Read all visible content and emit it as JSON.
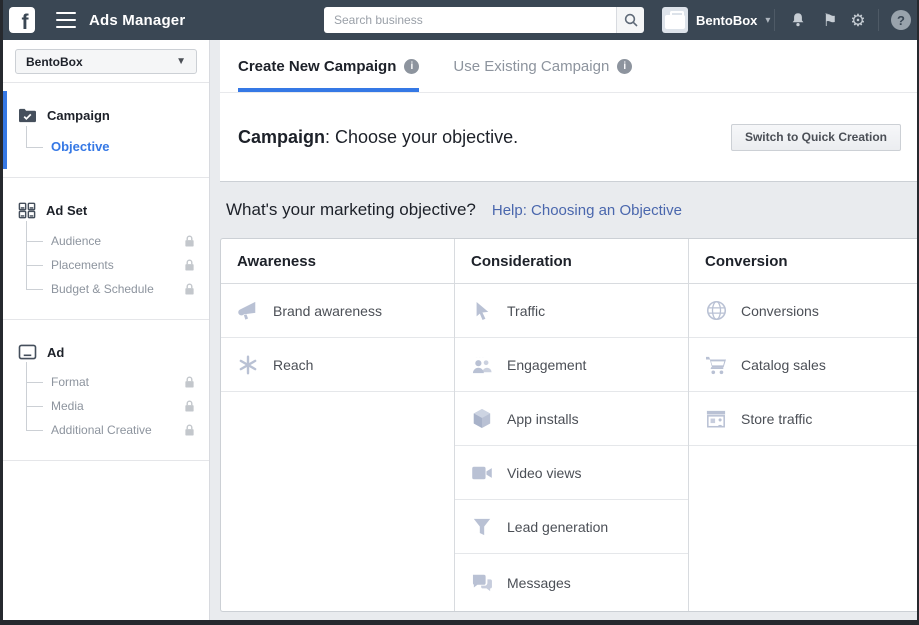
{
  "colors": {
    "header_bg": "#3a4754",
    "accent_blue": "#3578e5",
    "link_blue": "#4a67ad",
    "page_bg": "#e9ebee",
    "text_dark": "#1d2129",
    "text_gray": "#8d949e",
    "icon_muted": "#b9c1d4"
  },
  "header": {
    "app_title": "Ads Manager",
    "search_placeholder": "Search business",
    "account_name": "BentoBox",
    "icons": [
      "facebook-logo",
      "hamburger-menu",
      "search-magnifier",
      "notifications-bell",
      "flag",
      "settings-gear",
      "help-question"
    ]
  },
  "sidebar": {
    "account_selector": "BentoBox",
    "sections": [
      {
        "label": "Campaign",
        "icon": "campaign-folder-check",
        "children": [
          {
            "label": "Objective",
            "locked": false,
            "active": true
          }
        ]
      },
      {
        "label": "Ad Set",
        "icon": "adset-grid",
        "children": [
          {
            "label": "Audience",
            "locked": true
          },
          {
            "label": "Placements",
            "locked": true
          },
          {
            "label": "Budget & Schedule",
            "locked": true
          }
        ]
      },
      {
        "label": "Ad",
        "icon": "ad-card",
        "children": [
          {
            "label": "Format",
            "locked": true
          },
          {
            "label": "Media",
            "locked": true
          },
          {
            "label": "Additional Creative",
            "locked": true
          }
        ]
      }
    ]
  },
  "main": {
    "tabs": [
      {
        "label": "Create New Campaign",
        "active": true
      },
      {
        "label": "Use Existing Campaign",
        "active": false
      }
    ],
    "campaign_header": {
      "bold": "Campaign",
      "rest": ": Choose your objective."
    },
    "switch_button": "Switch to Quick Creation",
    "objective_question": "What's your marketing objective?",
    "help_link": "Help: Choosing an Objective",
    "table": {
      "columns": [
        {
          "header": "Awareness",
          "items": [
            {
              "label": "Brand awareness",
              "icon": "megaphone-icon"
            },
            {
              "label": "Reach",
              "icon": "reach-burst-icon"
            }
          ]
        },
        {
          "header": "Consideration",
          "items": [
            {
              "label": "Traffic",
              "icon": "cursor-icon"
            },
            {
              "label": "Engagement",
              "icon": "people-icon"
            },
            {
              "label": "App installs",
              "icon": "cube-icon"
            },
            {
              "label": "Video views",
              "icon": "video-camera-icon"
            },
            {
              "label": "Lead generation",
              "icon": "funnel-icon"
            },
            {
              "label": "Messages",
              "icon": "chat-bubbles-icon"
            }
          ]
        },
        {
          "header": "Conversion",
          "items": [
            {
              "label": "Conversions",
              "icon": "globe-icon"
            },
            {
              "label": "Catalog sales",
              "icon": "cart-icon"
            },
            {
              "label": "Store traffic",
              "icon": "storefront-icon"
            }
          ]
        }
      ]
    }
  }
}
